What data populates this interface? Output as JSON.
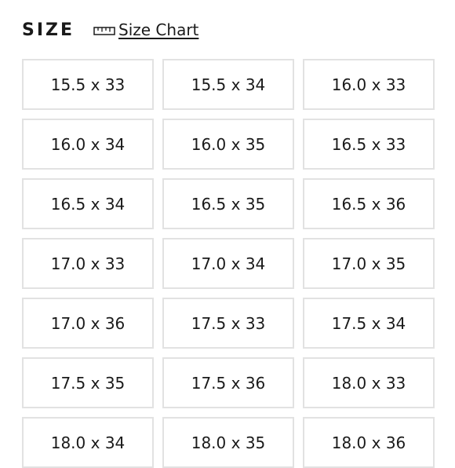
{
  "header": {
    "title": "SIZE",
    "size_chart_label": "Size Chart"
  },
  "icons": {
    "size_chart": "ruler-icon"
  },
  "colors": {
    "text": "#1a1a1a",
    "option_border": "#e2e2e2",
    "background": "#ffffff"
  },
  "sizes": [
    "15.5 x 33",
    "15.5 x 34",
    "16.0 x 33",
    "16.0 x 34",
    "16.0 x 35",
    "16.5 x 33",
    "16.5 x 34",
    "16.5 x 35",
    "16.5 x 36",
    "17.0 x 33",
    "17.0 x 34",
    "17.0 x 35",
    "17.0 x 36",
    "17.5 x 33",
    "17.5 x 34",
    "17.5 x 35",
    "17.5 x 36",
    "18.0 x 33",
    "18.0 x 34",
    "18.0 x 35",
    "18.0 x 36"
  ]
}
